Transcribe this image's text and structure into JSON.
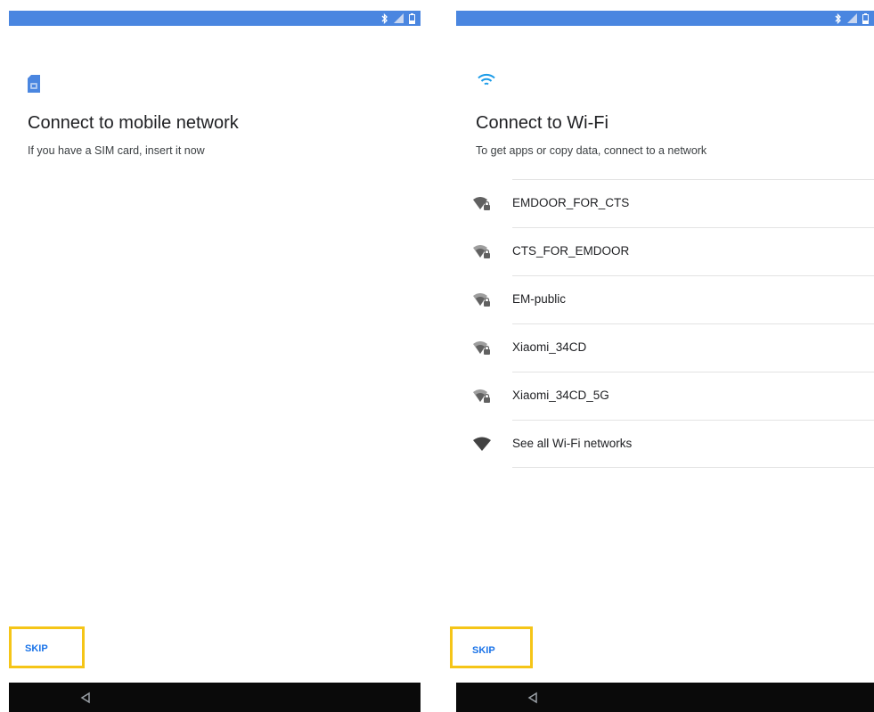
{
  "colors": {
    "status_bar": "#4a86e0",
    "accent": "#1a73e8",
    "highlight_frame": "#f5c518",
    "nav_bar": "#0a0a0a"
  },
  "left_screen": {
    "status_icons": [
      "bluetooth-icon",
      "signal-icon",
      "battery-icon"
    ],
    "header_icon": "sim-card-icon",
    "title": "Connect to mobile network",
    "subtitle": "If you have a SIM card, insert it now",
    "skip_label": "SKIP",
    "nav_icon": "back-icon"
  },
  "right_screen": {
    "status_icons": [
      "bluetooth-icon",
      "signal-icon",
      "battery-icon"
    ],
    "header_icon": "wifi-icon",
    "title": "Connect to Wi-Fi",
    "subtitle": "To get apps or copy data, connect to a network",
    "networks": [
      {
        "name": "EMDOOR_FOR_CTS",
        "icon": "wifi-lock-icon"
      },
      {
        "name": "CTS_FOR_EMDOOR",
        "icon": "wifi-lock-icon"
      },
      {
        "name": "EM-public",
        "icon": "wifi-lock-icon"
      },
      {
        "name": "Xiaomi_34CD",
        "icon": "wifi-lock-icon"
      },
      {
        "name": "Xiaomi_34CD_5G",
        "icon": "wifi-lock-icon"
      },
      {
        "name": "See all Wi-Fi networks",
        "icon": "wifi-icon"
      }
    ],
    "skip_label": "SKIP",
    "nav_icon": "back-icon"
  }
}
